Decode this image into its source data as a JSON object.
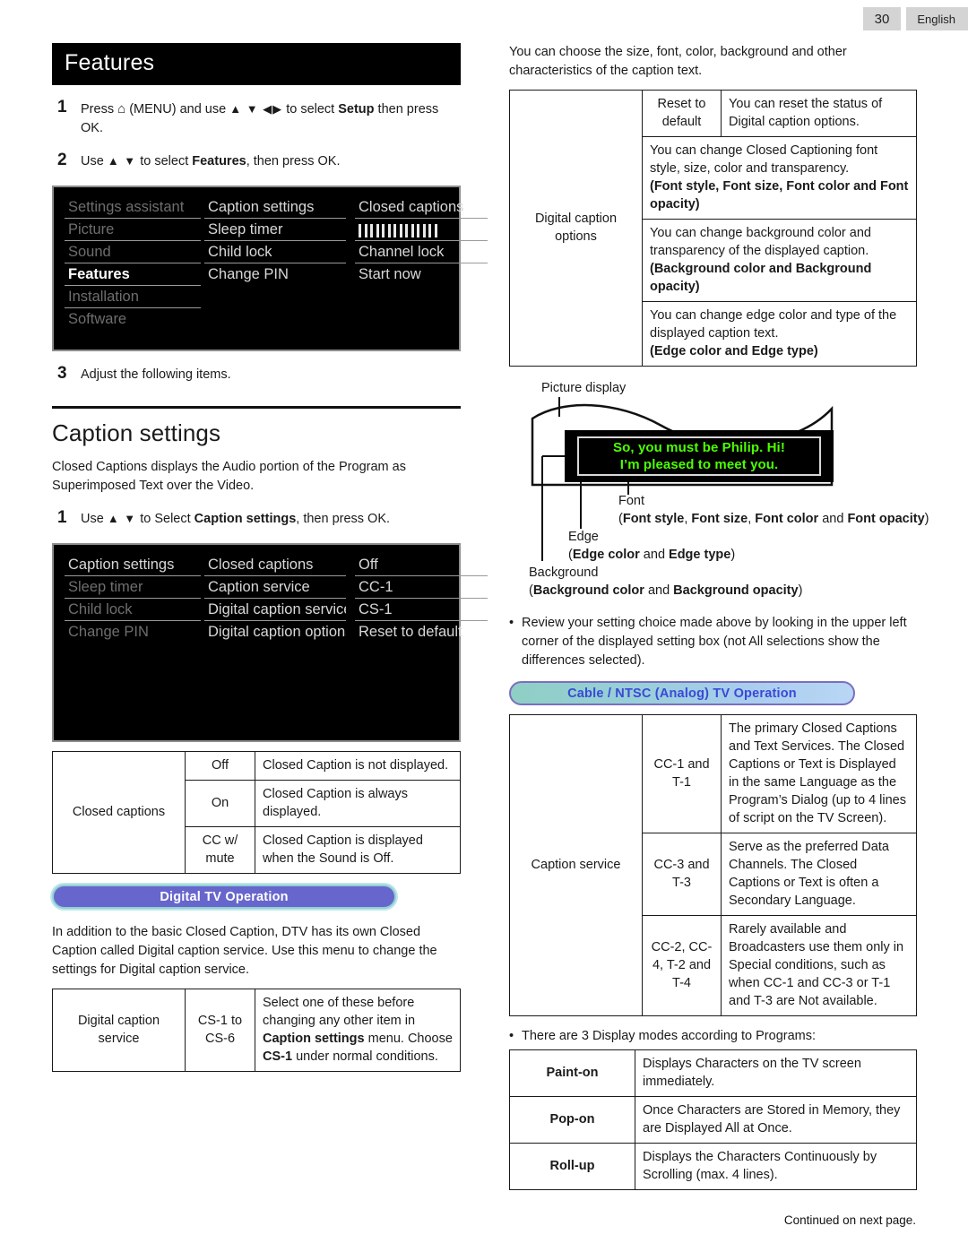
{
  "header": {
    "page_number": "30",
    "language": "English"
  },
  "footer": {
    "continued": "Continued on next page."
  },
  "left": {
    "section_title": "Features",
    "steps": [
      {
        "num": "1",
        "parts": [
          "Press ",
          "home-icon",
          " (MENU) and use ",
          "▲ ▼ ◀▶",
          " to select ",
          "Setup",
          " then press OK."
        ]
      },
      {
        "num": "2",
        "parts": [
          "Use ",
          "▲ ▼",
          " to select ",
          "Features",
          ", then press OK."
        ]
      },
      {
        "num": "3",
        "text": "Adjust the following items."
      }
    ],
    "step1_a": "Press",
    "step1_b": "(MENU) and use",
    "step1_arrows": "▲ ▼ ◀▶",
    "step1_c": "to select",
    "step1_bold": "Setup",
    "step1_d": "then press OK.",
    "step2_a": "Use",
    "step2_arrows": "▲ ▼",
    "step2_b": "to select",
    "step2_bold": "Features",
    "step2_c": ", then press OK.",
    "step3_text": "Adjust the following items.",
    "osd1": {
      "col1": [
        "Settings assistant",
        "Picture",
        "Sound",
        "Features",
        "Installation",
        "Software"
      ],
      "col2": [
        "Caption settings",
        "Sleep timer",
        "Child lock",
        "Change PIN"
      ],
      "col3": [
        "Closed captions",
        "slider",
        "Channel lock",
        "Start now"
      ],
      "selected_col1": "Features",
      "slider_ticks": 14
    },
    "caption_settings_heading": "Caption settings",
    "caption_intro": "Closed Captions displays the Audio portion of the Program as Superimposed Text over the Video.",
    "step_cs_num": "1",
    "step_cs_a": "Use",
    "step_cs_arrows": "▲ ▼",
    "step_cs_b": "to Select",
    "step_cs_bold": "Caption settings",
    "step_cs_c": ", then press OK.",
    "osd2": {
      "col1": [
        "Caption settings",
        "Sleep timer",
        "Child lock",
        "Change PIN"
      ],
      "col2": [
        "Closed captions",
        "Caption service",
        "Digital caption service",
        "Digital caption options"
      ],
      "col3": [
        "Off",
        "CC-1",
        "CS-1",
        "Reset to default"
      ],
      "selected_col1": "Caption settings"
    },
    "closed_captions_table": {
      "row_label": "Closed captions",
      "rows": [
        {
          "option": "Off",
          "desc": "Closed Caption is not displayed."
        },
        {
          "option": "On",
          "desc": "Closed Caption is always displayed."
        },
        {
          "option": "CC w/ mute",
          "desc": "Closed Caption is displayed when the Sound is Off."
        }
      ]
    },
    "banner_digital": "Digital TV Operation",
    "dtv_para": "In addition to the basic Closed Caption, DTV has its own Closed Caption called Digital caption service. Use this menu to change the settings for Digital caption service.",
    "digital_caption_service_table": {
      "row_label": "Digital caption service",
      "option": "CS-1 to CS-6",
      "desc_1": "Select one of these before changing any other item in ",
      "desc_bold_1": "Caption settings",
      "desc_2": " menu. Choose ",
      "desc_bold_2": "CS-1",
      "desc_3": " under normal conditions."
    }
  },
  "right": {
    "intro": "You can choose the size, font, color, background and other characteristics of the caption text.",
    "digital_caption_options_table": {
      "row_label": "Digital caption options",
      "rows": [
        {
          "option": "Reset to default",
          "desc": "You can reset the status of Digital caption options.",
          "bold_tail": ""
        },
        {
          "option": "",
          "desc": "You can change Closed Captioning font style, size, color and transparency.",
          "bold_tail": "(Font style, Font size, Font color and Font opacity)"
        },
        {
          "option": "",
          "desc": "You can change background color and transparency of the displayed caption.",
          "bold_tail": "(Background color and Background opacity)"
        },
        {
          "option": "",
          "desc": "You can change edge color and type of the displayed caption text.",
          "bold_tail": "(Edge color and Edge type)"
        }
      ]
    },
    "diagram": {
      "picture_display_label": "Picture display",
      "caption_line1": "So, you must be Philip. Hi!",
      "caption_line2": "I’m pleased to meet you.",
      "font_label": "Font",
      "font_detail": "(Font style, Font size, Font color and Font opacity)",
      "edge_label": "Edge",
      "edge_detail": "(Edge color and Edge type)",
      "background_label": "Background",
      "background_detail": "(Background color and Background opacity)"
    },
    "bullet_review": "Review your setting choice made above by looking in the upper left corner of the displayed setting box (not All selections show the differences selected).",
    "banner_cable": "Cable / NTSC (Analog) TV Operation",
    "caption_service_table": {
      "row_label": "Caption service",
      "rows": [
        {
          "option": "CC-1 and T-1",
          "desc": "The primary Closed Captions and Text Services. The Closed Captions or Text is Displayed in the same Language as the Program’s Dialog (up to 4 lines of script on the TV Screen)."
        },
        {
          "option": "CC-3 and T-3",
          "desc": "Serve as the preferred Data Channels. The Closed Captions or Text is often a Secondary Language."
        },
        {
          "option": "CC-2, CC-4, T-2 and T-4",
          "desc": "Rarely available and Broadcasters use them only in Special conditions, such as when CC-1 and CC-3 or T-1 and T-3 are Not available."
        }
      ]
    },
    "bullet_modes": "There are 3 Display modes according to Programs:",
    "display_modes_table": {
      "rows": [
        {
          "mode": "Paint-on",
          "desc": "Displays Characters on the TV screen immediately."
        },
        {
          "mode": "Pop-on",
          "desc": "Once Characters are Stored in Memory, they are Displayed All at Once."
        },
        {
          "mode": "Roll-up",
          "desc": "Displays the Characters Continuously by Scrolling (max. 4 lines)."
        }
      ]
    }
  },
  "colors": {
    "osd_background": "#000000",
    "osd_selected_text": "#ffffff",
    "osd_dim_text": "#6e6e6e",
    "caption_green": "#4cff00",
    "banner_digital_bg": "#6766cc",
    "banner_cable_text": "#3a49d6"
  }
}
